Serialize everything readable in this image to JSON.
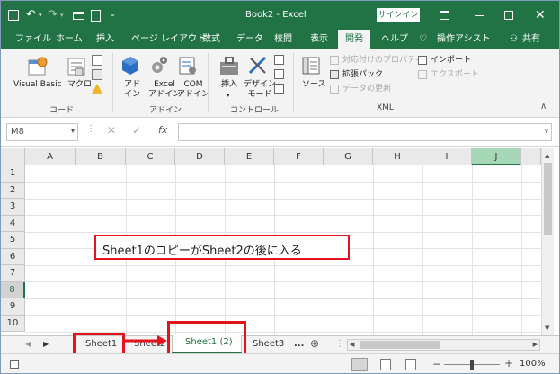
{
  "window": {
    "title": "Book2 - Excel",
    "signin": "サインイン"
  },
  "tabs": [
    "ファイル",
    "ホーム",
    "挿入",
    "ページ レイアウト",
    "数式",
    "データ",
    "校閲",
    "表示",
    "開発",
    "ヘルプ",
    "操作アシスト",
    "共有"
  ],
  "ribbon": {
    "code": {
      "visual_basic": "Visual Basic",
      "macro": "マクロ",
      "label": "コード"
    },
    "addins": {
      "addin": "アド\nイン",
      "excel_addin": "Excel\nアドイン",
      "com_addin": "COM\nアドイン",
      "label": "アドイン"
    },
    "controls": {
      "insert": "挿入",
      "design_mode": "デザイン\nモード",
      "label": "コントロール"
    },
    "xml": {
      "source": "ソース",
      "map_props": "対応付けのプロパティ",
      "expansion_pack": "拡張パック",
      "refresh": "データの更新",
      "import": "インポート",
      "export": "エクスポート",
      "label": "XML"
    }
  },
  "formula": {
    "name_box": "M8",
    "fx": "fx",
    "value": ""
  },
  "columns": [
    "A",
    "B",
    "C",
    "D",
    "E",
    "F",
    "G",
    "H",
    "I",
    "J"
  ],
  "rows": [
    "1",
    "2",
    "3",
    "4",
    "5",
    "6",
    "7",
    "8",
    "9",
    "10"
  ],
  "annotation": "Sheet1のコピーがSheet2の後に入る",
  "sheets": [
    "Sheet1",
    "Sheet2",
    "Sheet1 (2)",
    "Sheet3",
    "..."
  ],
  "status": {
    "zoom": "100%"
  }
}
